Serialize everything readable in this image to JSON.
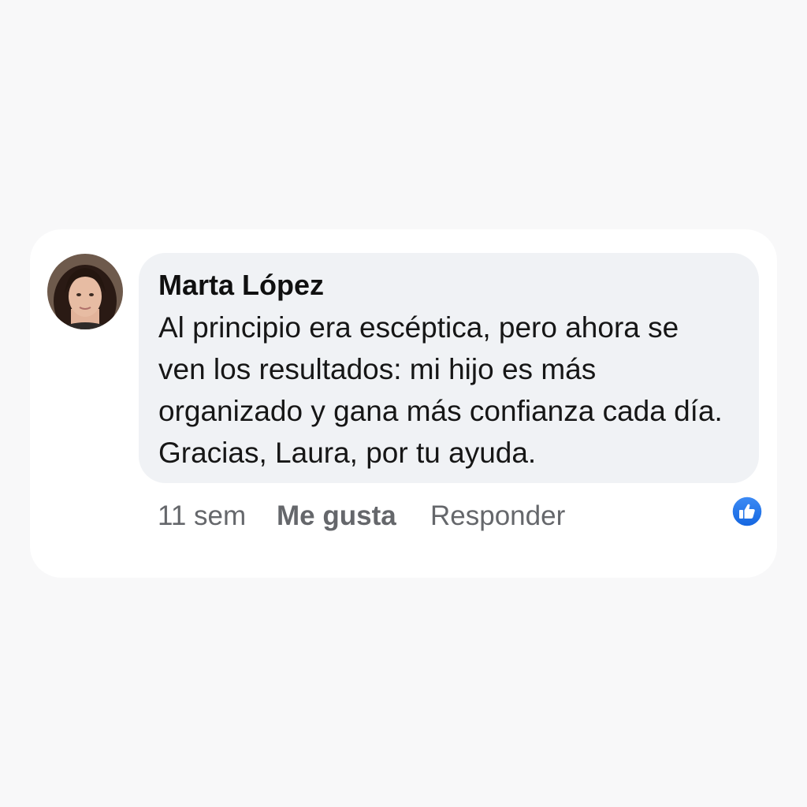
{
  "comment": {
    "author": "Marta López",
    "text": "Al principio era escéptica, pero ahora se ven los resultados: mi hijo es más organizado y gana más confianza cada día. Gracias, Laura, por tu ayuda.",
    "timestamp": "11 sem",
    "like_label": "Me gusta",
    "reply_label": "Responder",
    "reaction_icon": "thumbs-up-icon"
  },
  "colors": {
    "page_background": "#f8f8f9",
    "card_background": "#ffffff",
    "bubble_background": "#f0f2f5",
    "meta_text": "#65676b",
    "reaction_blue": "#1877f2"
  }
}
